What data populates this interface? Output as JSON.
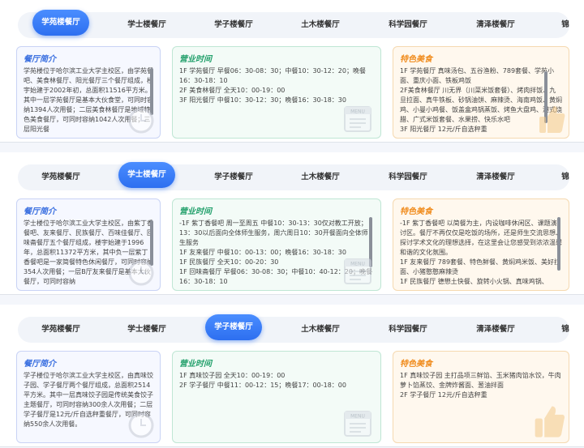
{
  "tabs": [
    "学苑楼餐厅",
    "学士楼餐厅",
    "学子楼餐厅",
    "土木楼餐厅",
    "科学园餐厅",
    "清泽楼餐厅",
    "锦"
  ],
  "section_titles": {
    "intro": "餐厅简介",
    "hours": "营业时间",
    "food": "特色美食"
  },
  "panels": [
    {
      "active_tab": 0,
      "intro": "学苑楼位于哈尔滨工业大学主校区，由学苑餐吧、美食林餐厅、阳光餐厅三个餐厅组成，楼宇始建于2002年初，总面积11516平方米。其中一层学苑餐厅是基本大伙食堂，可同时容纳1394人次用餐；二层美食林餐厅是地域特色美食餐厅，可同时容纳1042人次用餐；三层阳光餐",
      "hours": "1F 学苑餐厅 早餐06：30-08：30；中餐10：30-12：20；晚餐16：30-18：10\n2F 美食林餐厅 全天10：00-19：00\n3F 阳光餐厅 中餐10：30-12：30；晚餐16：30-18：30",
      "food": "1F 学苑餐厅 真味汤包、五谷渔粉、789套餐、学苑小面、重庆小面、铁板鸡饭\n2F美食林餐厅 川无界（川菜米饭套餐）、烤肉拌饭、九旦拉面、真牛铁板、砂锅油饼、麻辣烫、海南鸡饭、黄焖鸡、小曼小鸡餐、饭盖盒鸡锅蒸饭、烤鱼大盘鸡、港式烧腊、广式米饭套餐、水果捞、快乐水吧\n3F 阳光餐厅 12元/斤自选秤重"
    },
    {
      "active_tab": 1,
      "intro": "学士楼位于哈尔滨工业大学主校区，由紫丁香餐吧、友来餐厅、民族餐厅、百味佳餐厅、回味斋餐厅五个餐厅组成，楼宇始建于1996年，总面积11372平方米，其中负一层紫丁香餐吧是一家简餐特色休闲餐厅，可同时容纳354人次用餐；一层B厅友来餐厅是基本大伙餐厅，可同时容纳",
      "hours": "-1F 紫丁香餐吧 周一至周五 中餐10：30-13：30仅对教工开放；13：30以后面向全体师生服务，周六周日10：30开餐面向全体师生服务\n1F 友来餐厅 中餐10：00-13：00；晚餐16：30-18：30\n1F 民族餐厅 全天10：00-20：30\n1F 回味斋餐厅 早餐06：30-08：30；中餐10：40-12：20；晚餐16：30-18：10",
      "food": "-1F 紫丁香餐吧 以简餐为主，内设咖啡休闲区、课题演讨区。餐厅不再仅仅是吃饭的场所，还是师生交流思想、探讨学术文化的理想选择，在这里会让您感受到浓浓温馨和谐的文化氛围。\n1F 友来餐厅 789套餐、特色鲜餐、黄焖鸡米饭、美好拉面、小猪憨憨麻辣烫\n1F 民族餐厅 德懋土快餐、旋转小火锅、真味鸡锅、"
    },
    {
      "active_tab": 2,
      "intro": "学子楼位于哈尔滨工业大学主校区，由真味饺子园、学子餐厅两个餐厅组成，总面积2514平方米。其中一层真味饺子园是传统美食饺子主题餐厅，可同时容纳300余人次用餐；二层学子餐厅是12元/斤自选秤重餐厅，可同时容纳550余人次用餐。",
      "hours": "1F 真味饺子园 全天10：00-19：00\n2F 学子餐厅 中餐11：00-12：15；晚餐17：00-18：00",
      "food": "1F 真味饺子园 主打品项三鲜馅、玉米猪肉馅水饺，牛肉萝卜馅蒸饺、金牌炸酱面、葱油拌面\n2F 学子餐厅 12元/斤自选秤重"
    }
  ],
  "colors": {
    "active_tab": "#2d6ff0",
    "intro": "#3a6fe0",
    "hours": "#22a06b",
    "food": "#f08c1e"
  },
  "icons": [
    "menu-board-icon",
    "clock-icon",
    "thumbs-up-icon"
  ]
}
